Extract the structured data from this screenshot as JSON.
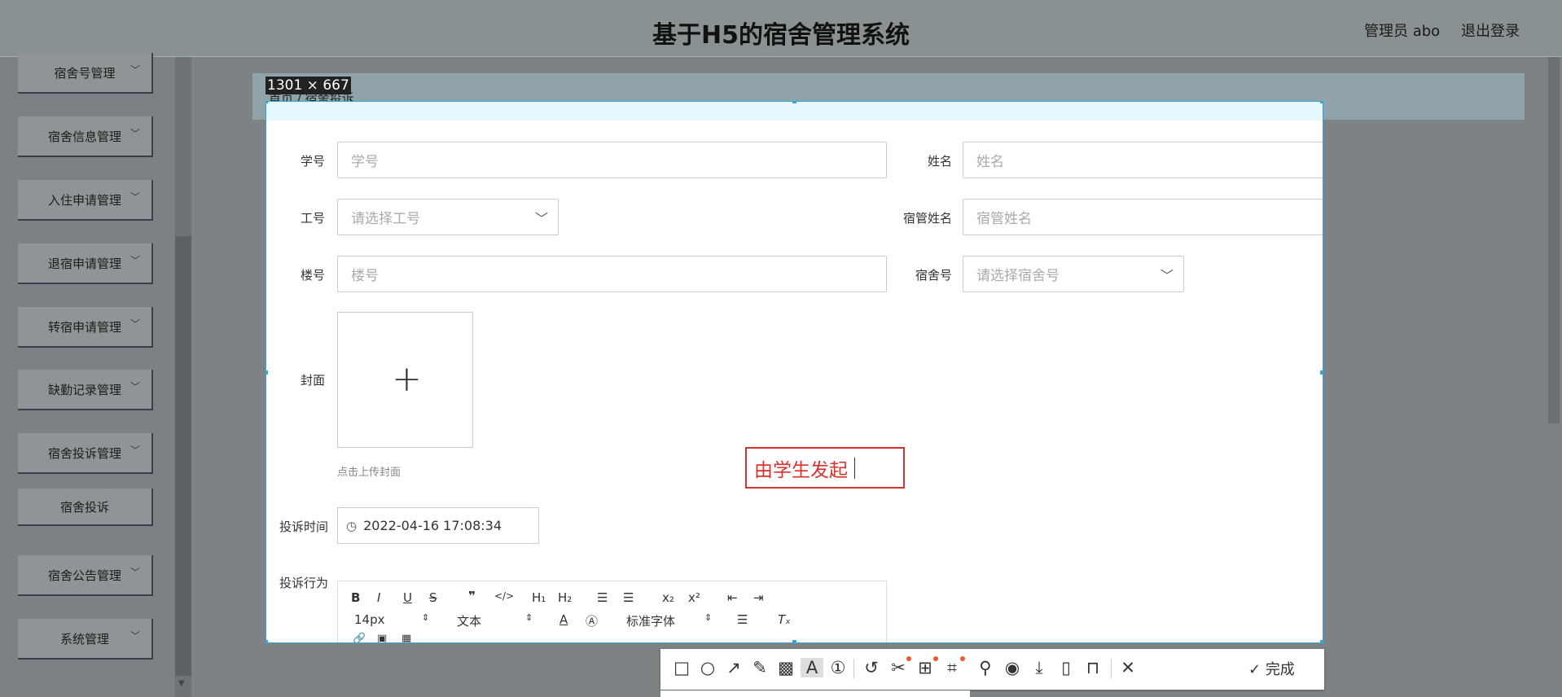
{
  "header": {
    "title": "基于H5的宿舍管理系统",
    "user": "管理员 abo",
    "logout": "退出登录"
  },
  "sidebar": {
    "items": [
      {
        "label": "宿舍号管理"
      },
      {
        "label": "宿舍信息管理"
      },
      {
        "label": "入住申请管理"
      },
      {
        "label": "退宿申请管理"
      },
      {
        "label": "转宿申请管理"
      },
      {
        "label": "缺勤记录管理"
      },
      {
        "label": "宿舍投诉管理"
      },
      {
        "label": "宿舍投诉"
      },
      {
        "label": "宿舍公告管理"
      },
      {
        "label": "系统管理"
      }
    ]
  },
  "breadcrumb": "首页 / 宿舍投诉",
  "capture": {
    "dimensions": "1301 × 667"
  },
  "form": {
    "student_no": {
      "label": "学号",
      "placeholder": "学号"
    },
    "name": {
      "label": "姓名",
      "placeholder": "姓名"
    },
    "staff_no": {
      "label": "工号",
      "placeholder": "请选择工号"
    },
    "manager_name": {
      "label": "宿管姓名",
      "placeholder": "宿管姓名"
    },
    "building_no": {
      "label": "楼号",
      "placeholder": "楼号"
    },
    "dorm_no": {
      "label": "宿舍号",
      "placeholder": "请选择宿舍号"
    },
    "cover": {
      "label": "封面",
      "hint": "点击上传封面"
    },
    "complaint_time": {
      "label": "投诉时间",
      "value": "2022-04-16 17:08:34"
    },
    "complaint_behavior": {
      "label": "投诉行为"
    }
  },
  "editor_toolbar": {
    "font_size": "14px",
    "text_style": "文本",
    "font_family": "标准字体"
  },
  "annotation": {
    "text": "由学生发起"
  },
  "capture_toolbar": {
    "done_label": "完成"
  },
  "colors": {
    "selection": "#2fa6e0",
    "annotation": "#d9312e"
  }
}
